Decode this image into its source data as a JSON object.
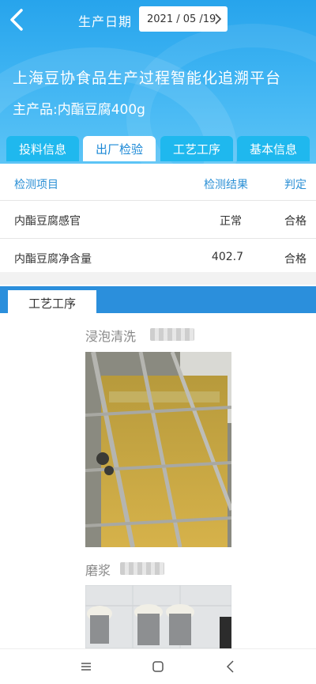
{
  "topbar": {
    "date_label": "生产日期",
    "date_value": "2021 / 05 /19"
  },
  "banner": {
    "platform_title": "上海豆协食品生产过程智能化追溯平台",
    "product_line": "主产品:内酯豆腐400g"
  },
  "tabs": [
    {
      "label": "投料信息",
      "active": false
    },
    {
      "label": "出厂检验",
      "active": true
    },
    {
      "label": "工艺工序",
      "active": false
    },
    {
      "label": "基本信息",
      "active": false
    }
  ],
  "inspection_table": {
    "headers": [
      "检测项目",
      "检测结果",
      "判定"
    ],
    "rows": [
      [
        "内酯豆腐感官",
        "正常",
        "合格"
      ],
      [
        "内酯豆腐净含量",
        "402.7",
        "合格"
      ]
    ]
  },
  "process_section": {
    "tab_label": "工艺工序",
    "steps": [
      {
        "title": "浸泡清洗"
      },
      {
        "title": "磨浆"
      }
    ]
  },
  "icons": {
    "back": "back-arrow-icon",
    "date_chevron": "chevron-right-icon",
    "nav_menu": "menu-icon",
    "nav_home": "home-icon",
    "nav_back": "back-icon"
  },
  "colors": {
    "header_blue": "#27a4ec",
    "tab_blue": "#1fb8ee",
    "accent_text": "#2a8fd5",
    "section_bar": "#2b8fdc"
  }
}
